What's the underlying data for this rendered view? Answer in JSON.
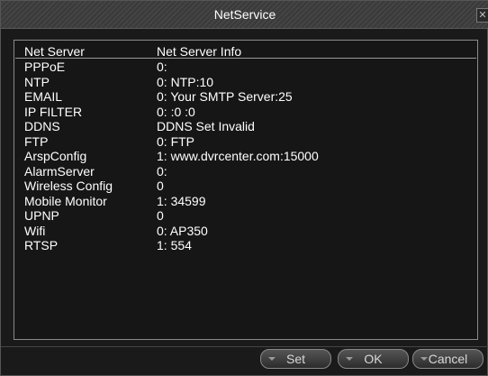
{
  "window": {
    "title": "NetService",
    "close_glyph": "✕"
  },
  "table": {
    "headers": [
      "Net Server",
      "Net Server Info"
    ],
    "rows": [
      {
        "server": "PPPoE",
        "info": "0:"
      },
      {
        "server": "NTP",
        "info": "0: NTP:10"
      },
      {
        "server": "EMAIL",
        "info": "0: Your SMTP Server:25"
      },
      {
        "server": "IP FILTER",
        "info": "0: :0 :0"
      },
      {
        "server": "DDNS",
        "info": "DDNS Set Invalid"
      },
      {
        "server": "FTP",
        "info": "0: FTP"
      },
      {
        "server": "ArspConfig",
        "info": "1: www.dvrcenter.com:15000"
      },
      {
        "server": "AlarmServer",
        "info": "0:"
      },
      {
        "server": "Wireless Config",
        "info": "0"
      },
      {
        "server": "Mobile Monitor",
        "info": "1: 34599"
      },
      {
        "server": "UPNP",
        "info": "0"
      },
      {
        "server": "Wifi",
        "info": "0: AP350"
      },
      {
        "server": "RTSP",
        "info": "1: 554"
      }
    ]
  },
  "buttons": {
    "set": "Set",
    "ok": "OK",
    "cancel": "Cancel"
  }
}
